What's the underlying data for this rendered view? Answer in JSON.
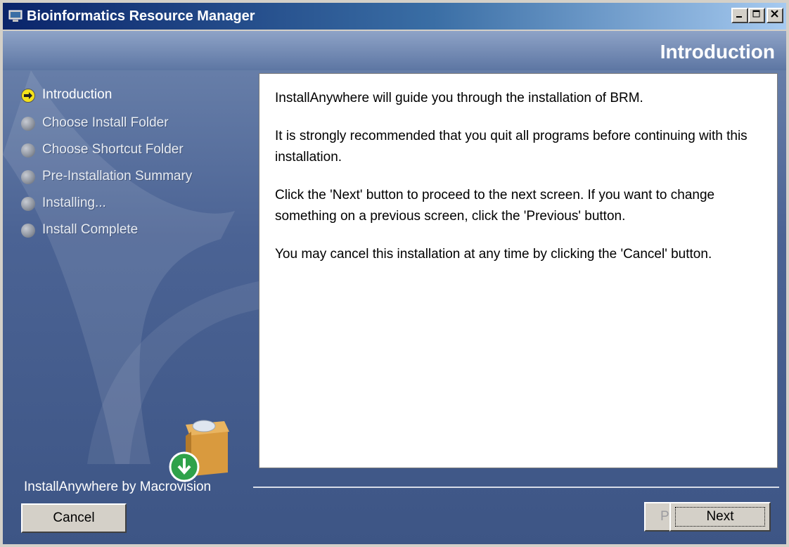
{
  "window": {
    "title": "Bioinformatics Resource Manager"
  },
  "header": {
    "title": "Introduction"
  },
  "steps": [
    {
      "label": "Introduction",
      "active": true
    },
    {
      "label": "Choose Install Folder",
      "active": false
    },
    {
      "label": "Choose Shortcut Folder",
      "active": false
    },
    {
      "label": "Pre-Installation Summary",
      "active": false
    },
    {
      "label": "Installing...",
      "active": false
    },
    {
      "label": "Install Complete",
      "active": false
    }
  ],
  "content": {
    "paragraphs": [
      "InstallAnywhere will guide you through the installation of BRM.",
      "It is strongly recommended that you quit all programs before continuing with this installation.",
      "Click the 'Next' button to proceed to the next screen. If you want to change something on a previous screen, click the 'Previous' button.",
      "You may cancel this installation at any time by clicking the 'Cancel' button."
    ]
  },
  "footer": {
    "brand": "InstallAnywhere by Macrovision",
    "cancel_label": "Cancel",
    "previous_label": "Previous",
    "next_label": "Next"
  }
}
